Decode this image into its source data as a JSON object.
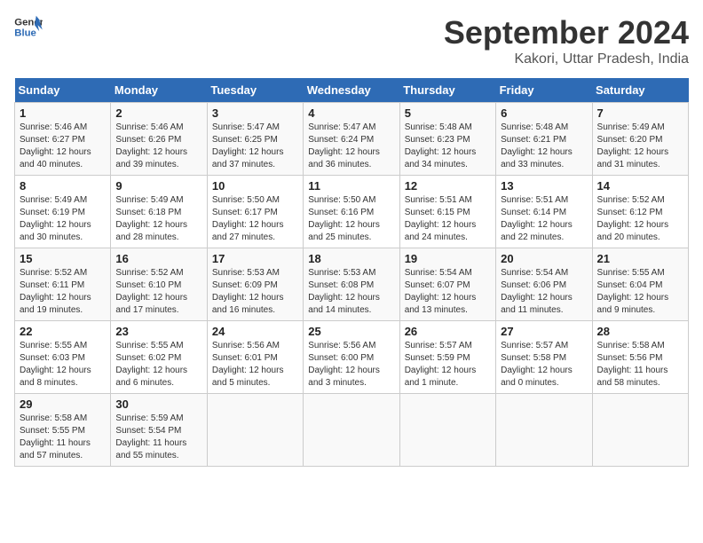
{
  "header": {
    "logo_line1": "General",
    "logo_line2": "Blue",
    "month": "September 2024",
    "location": "Kakori, Uttar Pradesh, India"
  },
  "weekdays": [
    "Sunday",
    "Monday",
    "Tuesday",
    "Wednesday",
    "Thursday",
    "Friday",
    "Saturday"
  ],
  "weeks": [
    [
      {
        "day": "1",
        "sunrise": "5:46 AM",
        "sunset": "6:27 PM",
        "daylight": "12 hours and 40 minutes."
      },
      {
        "day": "2",
        "sunrise": "5:46 AM",
        "sunset": "6:26 PM",
        "daylight": "12 hours and 39 minutes."
      },
      {
        "day": "3",
        "sunrise": "5:47 AM",
        "sunset": "6:25 PM",
        "daylight": "12 hours and 37 minutes."
      },
      {
        "day": "4",
        "sunrise": "5:47 AM",
        "sunset": "6:24 PM",
        "daylight": "12 hours and 36 minutes."
      },
      {
        "day": "5",
        "sunrise": "5:48 AM",
        "sunset": "6:23 PM",
        "daylight": "12 hours and 34 minutes."
      },
      {
        "day": "6",
        "sunrise": "5:48 AM",
        "sunset": "6:21 PM",
        "daylight": "12 hours and 33 minutes."
      },
      {
        "day": "7",
        "sunrise": "5:49 AM",
        "sunset": "6:20 PM",
        "daylight": "12 hours and 31 minutes."
      }
    ],
    [
      {
        "day": "8",
        "sunrise": "5:49 AM",
        "sunset": "6:19 PM",
        "daylight": "12 hours and 30 minutes."
      },
      {
        "day": "9",
        "sunrise": "5:49 AM",
        "sunset": "6:18 PM",
        "daylight": "12 hours and 28 minutes."
      },
      {
        "day": "10",
        "sunrise": "5:50 AM",
        "sunset": "6:17 PM",
        "daylight": "12 hours and 27 minutes."
      },
      {
        "day": "11",
        "sunrise": "5:50 AM",
        "sunset": "6:16 PM",
        "daylight": "12 hours and 25 minutes."
      },
      {
        "day": "12",
        "sunrise": "5:51 AM",
        "sunset": "6:15 PM",
        "daylight": "12 hours and 24 minutes."
      },
      {
        "day": "13",
        "sunrise": "5:51 AM",
        "sunset": "6:14 PM",
        "daylight": "12 hours and 22 minutes."
      },
      {
        "day": "14",
        "sunrise": "5:52 AM",
        "sunset": "6:12 PM",
        "daylight": "12 hours and 20 minutes."
      }
    ],
    [
      {
        "day": "15",
        "sunrise": "5:52 AM",
        "sunset": "6:11 PM",
        "daylight": "12 hours and 19 minutes."
      },
      {
        "day": "16",
        "sunrise": "5:52 AM",
        "sunset": "6:10 PM",
        "daylight": "12 hours and 17 minutes."
      },
      {
        "day": "17",
        "sunrise": "5:53 AM",
        "sunset": "6:09 PM",
        "daylight": "12 hours and 16 minutes."
      },
      {
        "day": "18",
        "sunrise": "5:53 AM",
        "sunset": "6:08 PM",
        "daylight": "12 hours and 14 minutes."
      },
      {
        "day": "19",
        "sunrise": "5:54 AM",
        "sunset": "6:07 PM",
        "daylight": "12 hours and 13 minutes."
      },
      {
        "day": "20",
        "sunrise": "5:54 AM",
        "sunset": "6:06 PM",
        "daylight": "12 hours and 11 minutes."
      },
      {
        "day": "21",
        "sunrise": "5:55 AM",
        "sunset": "6:04 PM",
        "daylight": "12 hours and 9 minutes."
      }
    ],
    [
      {
        "day": "22",
        "sunrise": "5:55 AM",
        "sunset": "6:03 PM",
        "daylight": "12 hours and 8 minutes."
      },
      {
        "day": "23",
        "sunrise": "5:55 AM",
        "sunset": "6:02 PM",
        "daylight": "12 hours and 6 minutes."
      },
      {
        "day": "24",
        "sunrise": "5:56 AM",
        "sunset": "6:01 PM",
        "daylight": "12 hours and 5 minutes."
      },
      {
        "day": "25",
        "sunrise": "5:56 AM",
        "sunset": "6:00 PM",
        "daylight": "12 hours and 3 minutes."
      },
      {
        "day": "26",
        "sunrise": "5:57 AM",
        "sunset": "5:59 PM",
        "daylight": "12 hours and 1 minute."
      },
      {
        "day": "27",
        "sunrise": "5:57 AM",
        "sunset": "5:58 PM",
        "daylight": "12 hours and 0 minutes."
      },
      {
        "day": "28",
        "sunrise": "5:58 AM",
        "sunset": "5:56 PM",
        "daylight": "11 hours and 58 minutes."
      }
    ],
    [
      {
        "day": "29",
        "sunrise": "5:58 AM",
        "sunset": "5:55 PM",
        "daylight": "11 hours and 57 minutes."
      },
      {
        "day": "30",
        "sunrise": "5:59 AM",
        "sunset": "5:54 PM",
        "daylight": "11 hours and 55 minutes."
      },
      null,
      null,
      null,
      null,
      null
    ]
  ]
}
